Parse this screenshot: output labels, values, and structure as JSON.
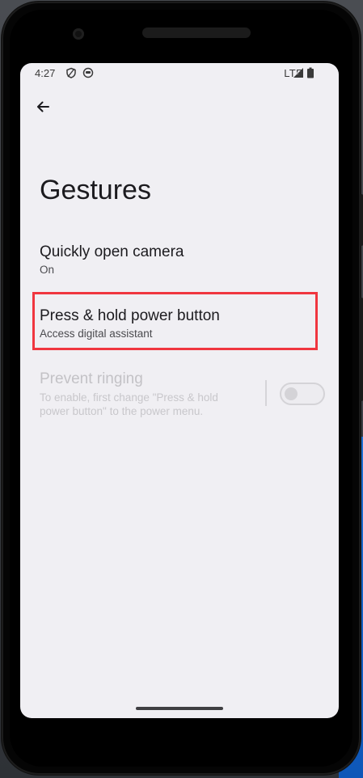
{
  "status_bar": {
    "time": "4:27",
    "network": "LTE",
    "icons": [
      "shield-icon",
      "face-icon",
      "signal-icon",
      "battery-icon"
    ]
  },
  "toolbar": {
    "back_icon": "arrow-back-icon"
  },
  "page": {
    "title": "Gestures"
  },
  "preferences": [
    {
      "title": "Quickly open camera",
      "summary": "On",
      "enabled": true
    },
    {
      "title": "Press & hold power button",
      "summary": "Access digital assistant",
      "enabled": true,
      "highlighted": true
    },
    {
      "title": "Prevent ringing",
      "summary_line1": "To enable, first change \"Press & hold",
      "summary_line2": "power button\" to the power menu.",
      "enabled": false,
      "switch_on": false
    }
  ],
  "colors": {
    "screen_bg": "#f0eff3",
    "highlight_border": "#f0363f",
    "text_primary": "#1c1b1f",
    "text_disabled": "#c3c2c6"
  }
}
